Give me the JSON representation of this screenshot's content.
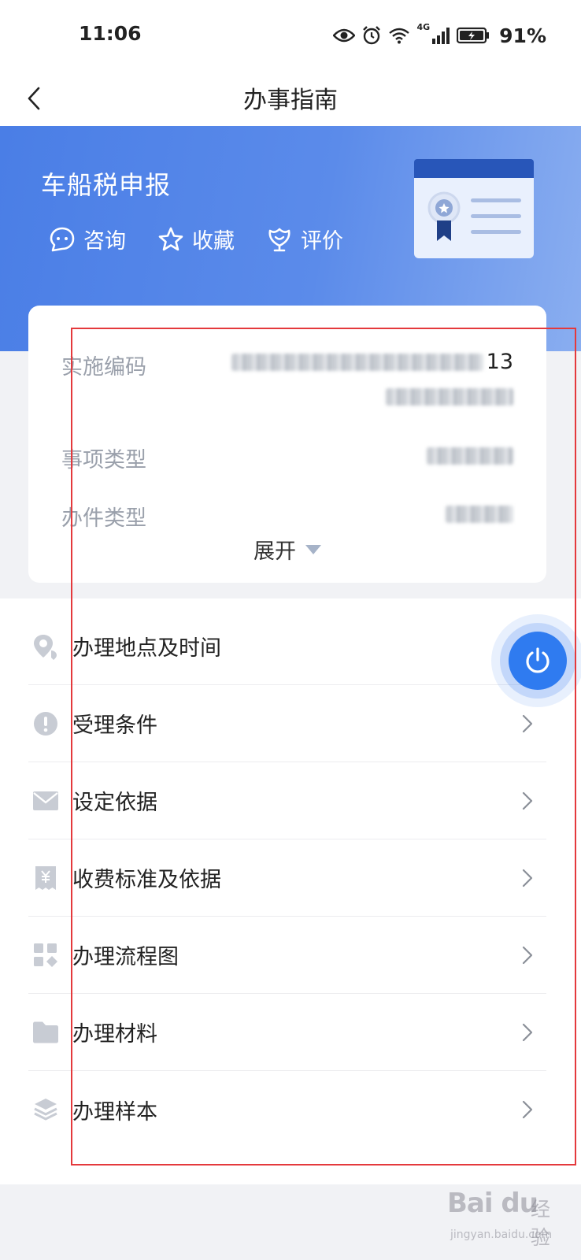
{
  "status_bar": {
    "time": "11:06",
    "network": "4G",
    "battery": "91%"
  },
  "nav": {
    "title": "办事指南"
  },
  "banner": {
    "title": "车船税申报",
    "actions": [
      {
        "label": "咨询",
        "icon": "chat-icon"
      },
      {
        "label": "收藏",
        "icon": "star-icon"
      },
      {
        "label": "评价",
        "icon": "rate-icon"
      }
    ]
  },
  "info_card": {
    "rows": [
      {
        "label": "实施编码",
        "value_suffix": "13"
      },
      {
        "label": "事项类型"
      },
      {
        "label": "办件类型"
      }
    ],
    "expand_label": "展开"
  },
  "list": {
    "items": [
      {
        "label": "办理地点及时间",
        "icon": "location-icon"
      },
      {
        "label": "受理条件",
        "icon": "alert-icon"
      },
      {
        "label": "设定依据",
        "icon": "mail-icon"
      },
      {
        "label": "收费标准及依据",
        "icon": "receipt-icon"
      },
      {
        "label": "办理流程图",
        "icon": "flowchart-icon"
      },
      {
        "label": "办理材料",
        "icon": "folder-icon"
      },
      {
        "label": "办理样本",
        "icon": "layers-icon"
      }
    ]
  },
  "watermark": {
    "logo": "Bai du",
    "sub": "经验",
    "url": "jingyan.baidu.com"
  },
  "colors": {
    "banner_start": "#4a7ee6",
    "banner_end": "#8aaef0",
    "fab": "#2f7bf0",
    "annotation": "#e4393c"
  }
}
